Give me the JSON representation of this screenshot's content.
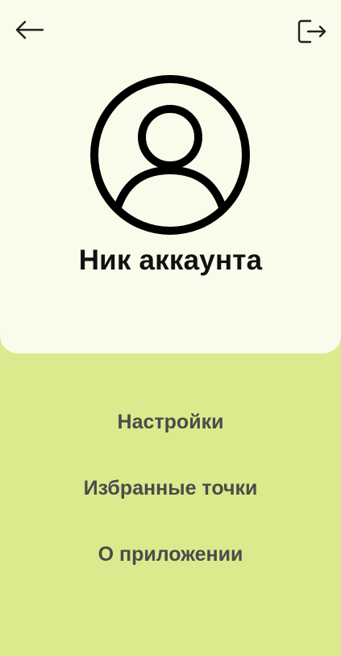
{
  "header": {
    "back_icon": "arrow-left-icon",
    "logout_icon": "logout-icon"
  },
  "profile": {
    "avatar_icon": "user-avatar-icon",
    "account_name": "Ник аккаунта"
  },
  "menu": {
    "items": [
      {
        "label": "Настройки"
      },
      {
        "label": "Избранные точки"
      },
      {
        "label": "О приложении"
      }
    ]
  },
  "colors": {
    "card_background": "#f9fbeb",
    "page_background": "#dce98c",
    "menu_text": "#4b4b4b",
    "title_text": "#111111"
  }
}
